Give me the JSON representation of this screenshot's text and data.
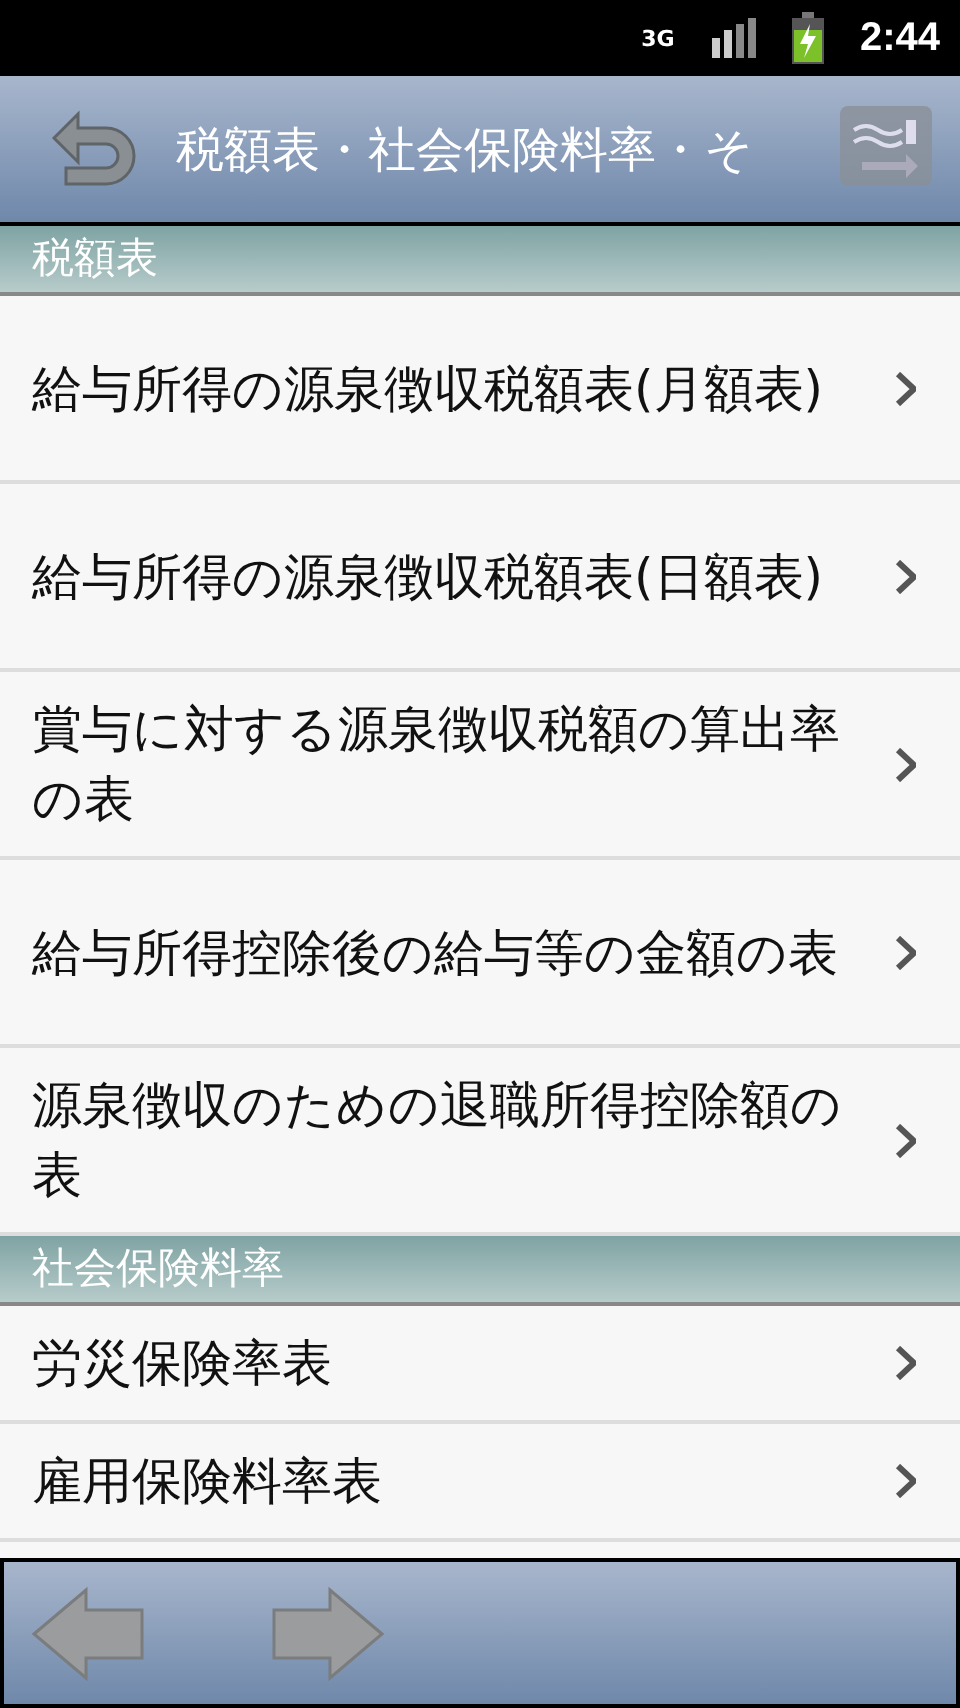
{
  "status_bar": {
    "network": "3G",
    "time": "2:44"
  },
  "title_bar": {
    "title": "税額表・社会保険料率・そ"
  },
  "sections": [
    {
      "header": "税額表",
      "items": [
        {
          "label": "給与所得の源泉徴収税額表(月額表)"
        },
        {
          "label": "給与所得の源泉徴収税額表(日額表)"
        },
        {
          "label": "賞与に対する源泉徴収税額の算出率の表"
        },
        {
          "label": "給与所得控除後の給与等の金額の表"
        },
        {
          "label": "源泉徴収のための退職所得控除額の表"
        }
      ]
    },
    {
      "header": "社会保険料率",
      "items": [
        {
          "label": "労災保険率表"
        },
        {
          "label": "雇用保険料率表"
        }
      ]
    }
  ]
}
